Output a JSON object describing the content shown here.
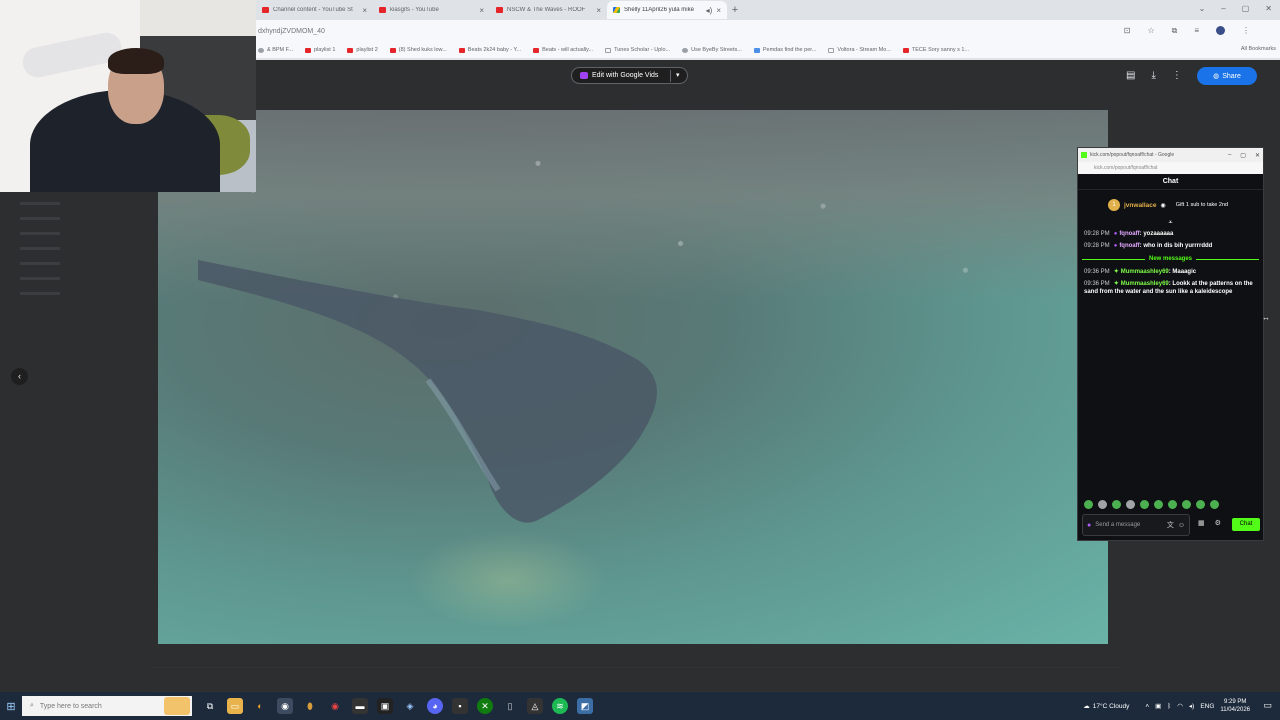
{
  "browser": {
    "tabs": [
      {
        "label": "Channel content - YouTube St",
        "fav": "youtube"
      },
      {
        "label": "kiasgifs - YouTube",
        "fav": "youtube"
      },
      {
        "label": "NSCW & The Waves - ROOF",
        "fav": "youtube"
      },
      {
        "label": "Shelly 11April26 yula mike",
        "fav": "drive",
        "active": true
      }
    ],
    "new_tab": "+",
    "url": "dxhyndjZVDMOM_40",
    "bookmarks": [
      {
        "label": "& BPM F...",
        "ico": "gray"
      },
      {
        "label": "playlist 1",
        "ico": "yt"
      },
      {
        "label": "playlist 2",
        "ico": "yt"
      },
      {
        "label": "(8) Shed kuks low...",
        "ico": "yt"
      },
      {
        "label": "Beats 2k24 baby - Y...",
        "ico": "yt"
      },
      {
        "label": "Beats - will actually...",
        "ico": "yt"
      },
      {
        "label": "Tunes Scholar - Uplo...",
        "ico": "none"
      },
      {
        "label": "Use ByeBy Streets...",
        "ico": "gray"
      },
      {
        "label": "Pemdas find the per...",
        "ico": "blue"
      },
      {
        "label": "Voltora - Stream Mo...",
        "ico": "none"
      },
      {
        "label": "TECE Sory sanny s 1...",
        "ico": "yt"
      }
    ],
    "all_bookmarks": "All Bookmarks"
  },
  "viewer": {
    "edit_button": "Edit with Google Vids",
    "share_button": "Share"
  },
  "chat": {
    "window_title": "kick.com/popout/fqnoaff/chat - Google",
    "url": "kick.com/popout/fqnoaff/chat",
    "header": "Chat",
    "pinned_user": "jvnwallace",
    "pinned_badge": "1",
    "pinned_gift": "Gift 1 sub to take 2nd",
    "messages_before": [
      {
        "time": "09:28 PM",
        "user": "fqnoaff",
        "text": "yozaaaaaa"
      },
      {
        "time": "09:28 PM",
        "user": "fqnoaff",
        "text": "who in dis bih yurrrrddd"
      }
    ],
    "new_messages_label": "New messages",
    "messages_after": [
      {
        "time": "09:36 PM",
        "user": "Mummaashley69",
        "text": "Maaagic"
      },
      {
        "time": "09:36 PM",
        "user": "Mummaashley69",
        "text": "Lookk at the patterns on the sand from the water and the sun like a kaleidescope"
      }
    ],
    "input_placeholder": "Send a message",
    "send_button": "Chat"
  },
  "taskbar": {
    "search_placeholder": "Type here to search",
    "weather": "17°C  Cloudy",
    "lang": "ENG",
    "time": "9:29 PM",
    "date": "11/04/2026"
  }
}
